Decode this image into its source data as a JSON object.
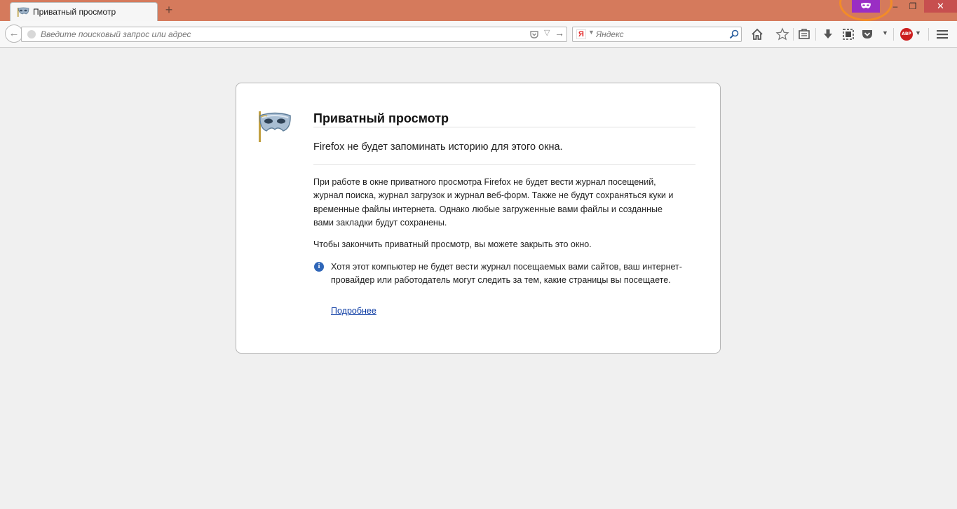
{
  "window": {
    "tab_title": "Приватный просмотр",
    "new_tab_symbol": "+",
    "minimize_symbol": "–",
    "maximize_symbol": "❐",
    "close_symbol": "✕",
    "private_browsing_color": "#9a2ec4",
    "titlebar_color": "#d57a5c"
  },
  "toolbar": {
    "back_symbol": "←",
    "url_placeholder": "Введите поисковый запрос или адрес",
    "url_value": "",
    "go_symbol": "→",
    "dropdown_symbol": "▽",
    "search_engine_logo": "Я",
    "search_placeholder": "Яндекс",
    "search_value": "",
    "icons": [
      "home-icon",
      "bookmark-star-icon",
      "reading-list-icon",
      "download-icon",
      "screenshot-icon",
      "pocket-icon",
      "abp-icon",
      "menu-icon"
    ],
    "abp_label": "ABP"
  },
  "page": {
    "title": "Приватный просмотр",
    "subtitle": "Firefox не будет запоминать историю для этого окна.",
    "body": "При работе в окне приватного просмотра Firefox не будет вести журнал посещений, журнал поиска, журнал загрузок и журнал веб-форм. Также не будут сохраняться куки и временные файлы интернета. Однако любые загруженные вами файлы и созданные вами закладки будут сохранены.",
    "close_hint": "Чтобы закончить приватный просмотр, вы можете закрыть это окно.",
    "info_symbol": "i",
    "info_text": "Хотя этот компьютер не будет вести журнал посещаемых вами сайтов, ваш интернет-провайдер или работодатель могут следить за тем, какие страницы вы посещаете.",
    "learn_more": "Подробнее"
  }
}
